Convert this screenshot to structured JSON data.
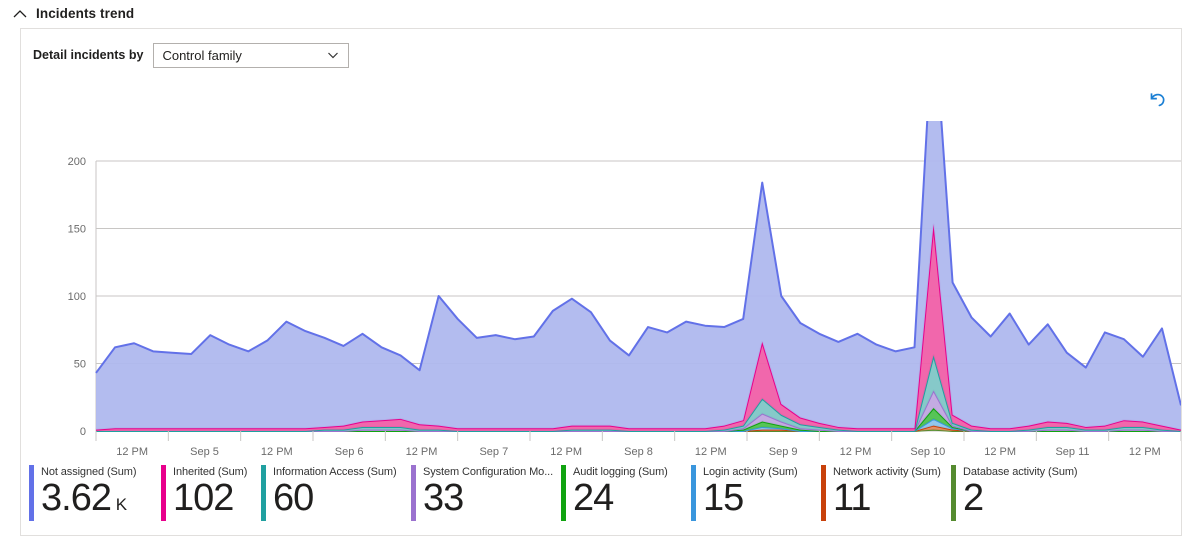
{
  "header": {
    "title": "Incidents trend",
    "collapse_icon": "chevron-up-icon"
  },
  "controls": {
    "detail_label": "Detail incidents by",
    "dropdown_value": "Control family",
    "dropdown_caret_icon": "chevron-down-icon",
    "reset_icon": "reset-arrow-icon"
  },
  "legend": [
    {
      "name": "Not assigned (Sum)",
      "value": "3.62",
      "suffix": "K",
      "color": "#6271E8"
    },
    {
      "name": "Inherited (Sum)",
      "value": "102",
      "suffix": "",
      "color": "#E8008C"
    },
    {
      "name": "Information Access (Sum)",
      "value": "60",
      "suffix": "",
      "color": "#20A0A0"
    },
    {
      "name": "System Configuration Mo...",
      "value": "33",
      "suffix": "",
      "color": "#9B72CF"
    },
    {
      "name": "Audit logging (Sum)",
      "value": "24",
      "suffix": "",
      "color": "#10A310"
    },
    {
      "name": "Login activity (Sum)",
      "value": "15",
      "suffix": "",
      "color": "#3A96DD"
    },
    {
      "name": "Network activity (Sum)",
      "value": "11",
      "suffix": "",
      "color": "#C8410B"
    },
    {
      "name": "Database activity (Sum)",
      "value": "2",
      "suffix": "",
      "color": "#558B2F"
    }
  ],
  "chart_data": {
    "type": "area",
    "title": "Incidents trend",
    "stacked": true,
    "xlabel": "",
    "ylabel": "",
    "ylim": [
      0,
      200
    ],
    "yticks": [
      0,
      50,
      100,
      150,
      200
    ],
    "grid": true,
    "legend_position": "bottom",
    "xtick_labels": [
      "12 PM",
      "Sep 5",
      "12 PM",
      "Sep 6",
      "12 PM",
      "Sep 7",
      "12 PM",
      "Sep 8",
      "12 PM",
      "Sep 9",
      "12 PM",
      "Sep 10",
      "12 PM",
      "Sep 11",
      "12 PM"
    ],
    "x": [
      0,
      1,
      2,
      3,
      4,
      5,
      6,
      7,
      8,
      9,
      10,
      11,
      12,
      13,
      14,
      15,
      16,
      17,
      18,
      19,
      20,
      21,
      22,
      23,
      24,
      25,
      26,
      27,
      28,
      29,
      30,
      31,
      32,
      33,
      34,
      35,
      36,
      37,
      38,
      39,
      40,
      41,
      42,
      43,
      44,
      45,
      46,
      47,
      48,
      49,
      50,
      51,
      52,
      53,
      54,
      55,
      56
    ],
    "series": [
      {
        "name": "Not assigned (Sum)",
        "color": "#6271E8",
        "fill": "#AFB8EE",
        "values": [
          42,
          60,
          63,
          57,
          56,
          55,
          69,
          62,
          57,
          65,
          79,
          72,
          66,
          59,
          65,
          54,
          47,
          40,
          96,
          81,
          67,
          69,
          66,
          68,
          87,
          94,
          84,
          63,
          54,
          75,
          71,
          79,
          76,
          73,
          75,
          118,
          80,
          70,
          66,
          63,
          70,
          62,
          57,
          60,
          160,
          98,
          80,
          68,
          85,
          60,
          72,
          52,
          44,
          69,
          60,
          48,
          72,
          18
        ]
      },
      {
        "name": "Inherited (Sum)",
        "color": "#E8008C",
        "fill": "#F05FA8",
        "values": [
          1,
          2,
          2,
          2,
          2,
          2,
          2,
          2,
          2,
          2,
          2,
          2,
          2,
          3,
          4,
          5,
          6,
          4,
          3,
          2,
          2,
          2,
          2,
          2,
          2,
          3,
          3,
          3,
          2,
          2,
          2,
          2,
          2,
          3,
          4,
          42,
          8,
          5,
          3,
          2,
          2,
          2,
          2,
          2,
          97,
          6,
          3,
          2,
          2,
          3,
          4,
          3,
          2,
          3,
          5,
          4,
          3,
          1
        ]
      },
      {
        "name": "Information Access (Sum)",
        "color": "#20A0A0",
        "fill": "#7FC6C6",
        "values": [
          0,
          0,
          0,
          0,
          0,
          0,
          0,
          0,
          0,
          0,
          0,
          0,
          1,
          1,
          2,
          2,
          2,
          1,
          1,
          0,
          0,
          0,
          0,
          0,
          0,
          1,
          1,
          1,
          0,
          0,
          0,
          0,
          0,
          1,
          2,
          11,
          5,
          3,
          2,
          1,
          0,
          0,
          0,
          0,
          26,
          2,
          1,
          0,
          0,
          1,
          2,
          2,
          1,
          1,
          2,
          2,
          1,
          0
        ]
      },
      {
        "name": "System Configuration Mo... (Sum)",
        "color": "#9B72CF",
        "fill": "#C0A6E0",
        "values": [
          0,
          0,
          0,
          0,
          0,
          0,
          0,
          0,
          0,
          0,
          0,
          0,
          0,
          0,
          1,
          1,
          1,
          0,
          0,
          0,
          0,
          0,
          0,
          0,
          0,
          0,
          0,
          0,
          0,
          0,
          0,
          0,
          0,
          0,
          1,
          6,
          3,
          1,
          1,
          0,
          0,
          0,
          0,
          0,
          13,
          1,
          0,
          0,
          0,
          0,
          1,
          1,
          0,
          0,
          1,
          1,
          0,
          0
        ]
      },
      {
        "name": "Audit logging (Sum)",
        "color": "#10A310",
        "fill": "#4EC14E",
        "values": [
          0,
          0,
          0,
          0,
          0,
          0,
          0,
          0,
          0,
          0,
          0,
          0,
          0,
          0,
          0,
          0,
          0,
          0,
          0,
          0,
          0,
          0,
          0,
          0,
          0,
          0,
          0,
          0,
          0,
          0,
          0,
          0,
          0,
          0,
          1,
          4,
          2,
          1,
          0,
          0,
          0,
          0,
          0,
          0,
          8,
          1,
          0,
          0,
          0,
          0,
          0,
          0,
          0,
          0,
          0,
          0,
          0,
          0
        ]
      },
      {
        "name": "Login activity (Sum)",
        "color": "#3A96DD",
        "fill": "#8CC4EC",
        "values": [
          0,
          0,
          0,
          0,
          0,
          0,
          0,
          0,
          0,
          0,
          0,
          0,
          0,
          0,
          0,
          0,
          0,
          0,
          0,
          0,
          0,
          0,
          0,
          0,
          0,
          0,
          0,
          0,
          0,
          0,
          0,
          0,
          0,
          0,
          0,
          2,
          1,
          0,
          0,
          0,
          0,
          0,
          0,
          0,
          5,
          1,
          0,
          0,
          0,
          0,
          0,
          0,
          0,
          0,
          0,
          0,
          0,
          0
        ]
      },
      {
        "name": "Network activity (Sum)",
        "color": "#C8410B",
        "fill": "#E08A5E",
        "values": [
          0,
          0,
          0,
          0,
          0,
          0,
          0,
          0,
          0,
          0,
          0,
          0,
          0,
          0,
          0,
          0,
          0,
          0,
          0,
          0,
          0,
          0,
          0,
          0,
          0,
          0,
          0,
          0,
          0,
          0,
          0,
          0,
          0,
          0,
          0,
          1,
          1,
          0,
          0,
          0,
          0,
          0,
          0,
          0,
          3,
          1,
          0,
          0,
          0,
          0,
          0,
          0,
          0,
          0,
          0,
          0,
          0,
          0
        ]
      },
      {
        "name": "Database activity (Sum)",
        "color": "#558B2F",
        "fill": "#9BC178",
        "values": [
          0,
          0,
          0,
          0,
          0,
          0,
          0,
          0,
          0,
          0,
          0,
          0,
          0,
          0,
          0,
          0,
          0,
          0,
          0,
          0,
          0,
          0,
          0,
          0,
          0,
          0,
          0,
          0,
          0,
          0,
          0,
          0,
          0,
          0,
          0,
          0,
          0,
          0,
          0,
          0,
          0,
          0,
          0,
          0,
          1,
          0,
          0,
          0,
          0,
          0,
          0,
          0,
          0,
          0,
          0,
          0,
          0,
          0
        ]
      }
    ]
  }
}
